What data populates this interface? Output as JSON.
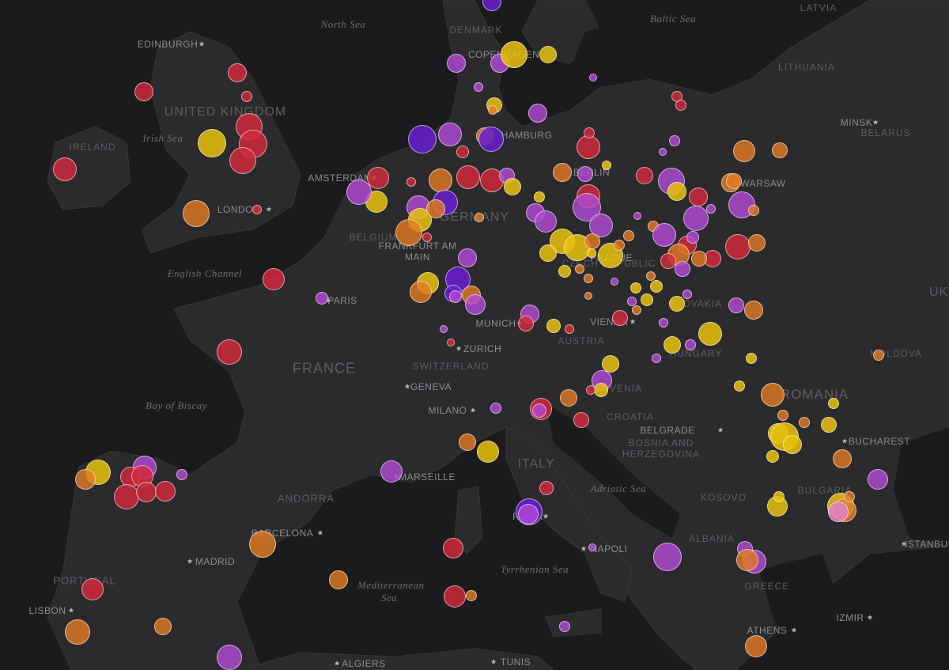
{
  "map": {
    "countries": [
      "LATVIA",
      "LITHUANIA",
      "DENMARK",
      "UNITED KINGDOM",
      "IRELAND",
      "BELARUS",
      "GERMANY",
      "BELGIUM",
      "FRANCE",
      "SWITZERLAND",
      "AUSTRIA",
      "SLOVAKIA",
      "HUNGARY",
      "ROMANIA",
      "MOLDOVA",
      "CROATIA",
      "BOSNIA AND HERZEGOVINA",
      "ITALY",
      "KOSOVO",
      "BULGARIA",
      "ALBANIA",
      "GREECE",
      "PORTUGAL",
      "ANDORRA",
      "CZECH REPUBLIC",
      "SLOVENIA",
      "UK"
    ],
    "seas": [
      "North Sea",
      "Baltic Sea",
      "Irish Sea",
      "English Channel",
      "Bay of Biscay",
      "Adriatic Sea",
      "Tyrrhenian Sea",
      "Mediterranean Sea"
    ],
    "cities": [
      "EDINBURGH",
      "COPENHAGEN",
      "HAMBURG",
      "AMSTERDAM",
      "BERLIN",
      "WARSAW",
      "MINSK",
      "LONDON",
      "FRANKFURT AM MAIN",
      "PARIS",
      "PRAGUE",
      "MUNICH",
      "VIENNA",
      "ZURICH",
      "GENEVA",
      "MILANO",
      "BELGRADE",
      "BUCHAREST",
      "MARSEILLE",
      "BARCELONA",
      "ROMA",
      "NAPOLI",
      "MADRID",
      "LISBON",
      "ISTANBUL",
      "IZMIR",
      "ATHENS",
      "ALGIERS",
      "TUNIS"
    ],
    "colors": {
      "red": "#d42a3c",
      "orange": "#e07a23",
      "yellow": "#e8c20a",
      "violet": "#b44ad8",
      "indigo": "#6a1fd0",
      "pink": "#e080c8",
      "background": "#1b1b1d",
      "land": "#2c2c2f"
    }
  }
}
